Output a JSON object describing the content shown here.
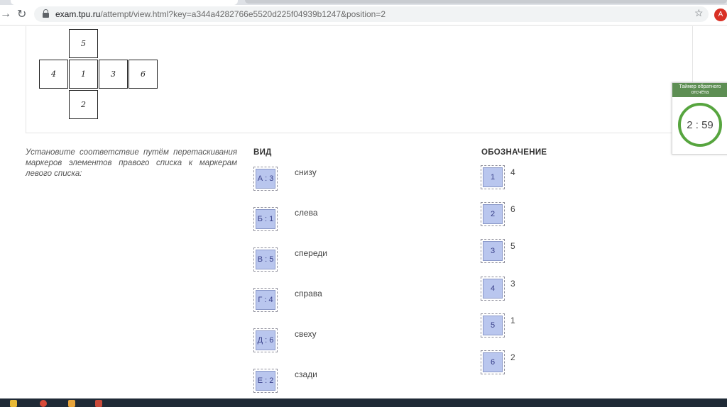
{
  "browser": {
    "url_host": "exam.tpu.ru",
    "url_path": "/attempt/view.html?key=a344a4282766e5520d225f04939b1247&position=2",
    "avatar_letter": "A"
  },
  "figure": {
    "net": [
      "5",
      "4",
      "1",
      "3",
      "6",
      "2"
    ]
  },
  "question": {
    "instruction": "Установите соответствие путём перетаскивания маркеров элементов правого списка к маркерам левого списка:",
    "left_header": "ВИД",
    "right_header": "ОБОЗНАЧЕНИЕ",
    "left_items": [
      {
        "marker": "А : 3",
        "label": "снизу"
      },
      {
        "marker": "Б : 1",
        "label": "слева"
      },
      {
        "marker": "В : 5",
        "label": "спереди"
      },
      {
        "marker": "Г : 4",
        "label": "справа"
      },
      {
        "marker": "Д : 6",
        "label": "свеху"
      },
      {
        "marker": "Е : 2",
        "label": "сзади"
      }
    ],
    "right_items": [
      {
        "marker": "1",
        "value": "4"
      },
      {
        "marker": "2",
        "value": "6"
      },
      {
        "marker": "3",
        "value": "5"
      },
      {
        "marker": "4",
        "value": "3"
      },
      {
        "marker": "5",
        "value": "1"
      },
      {
        "marker": "6",
        "value": "2"
      }
    ]
  },
  "timer": {
    "title": "Таймер обратного отсчёта",
    "value": "2 : 59"
  },
  "colors": {
    "marker_fill": "#b9c6ee",
    "timer_accent": "#57a53f",
    "timer_header": "#5d8e53"
  }
}
